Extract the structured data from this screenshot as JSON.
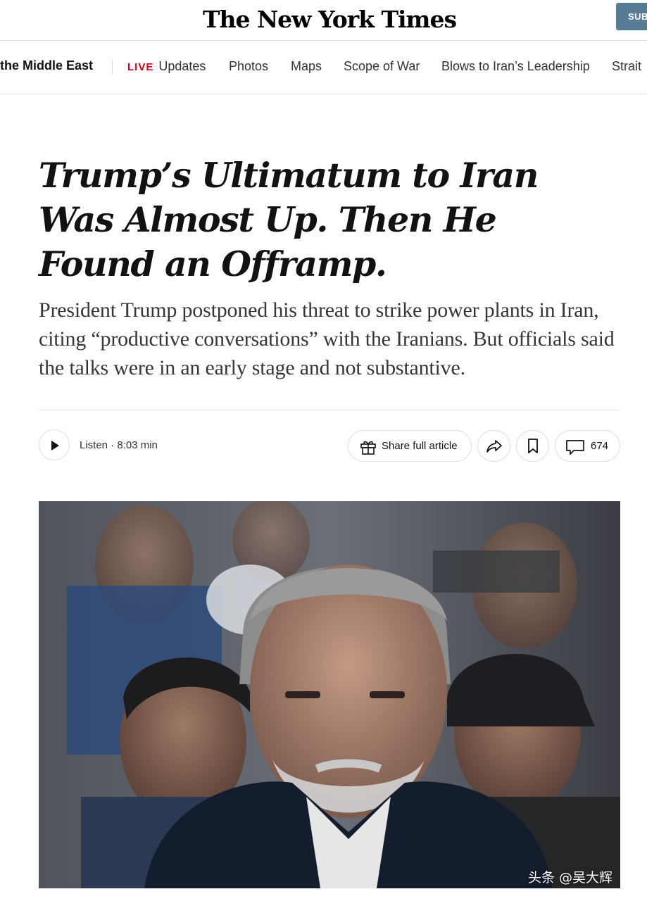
{
  "masthead": {
    "logo_text": "The New York Times",
    "subscribe_label": "SUB"
  },
  "section_nav": {
    "section": "the Middle East",
    "live_tag": "LIVE",
    "items": [
      "Updates",
      "Photos",
      "Maps",
      "Scope of War",
      "Blows to Iran’s Leadership",
      "Strait"
    ]
  },
  "article": {
    "headline": "Trump’s Ultimatum to Iran Was Almost Up. Then He Found an Offramp.",
    "summary": "President Trump postponed his threat to strike power plants in Iran, citing “productive conversations” with the Iranians. But officials said the talks were in an early stage and not substantive."
  },
  "toolbar": {
    "listen_label": "Listen · 8:03 min",
    "share_full_label": "Share full article",
    "comment_count": "674",
    "icons": [
      "play-icon",
      "gift-icon",
      "share-arrow-icon",
      "bookmark-icon",
      "comment-icon"
    ]
  },
  "photo": {
    "description_icon": "photo-image"
  },
  "watermark": {
    "text": "头条 @吴大辉"
  }
}
